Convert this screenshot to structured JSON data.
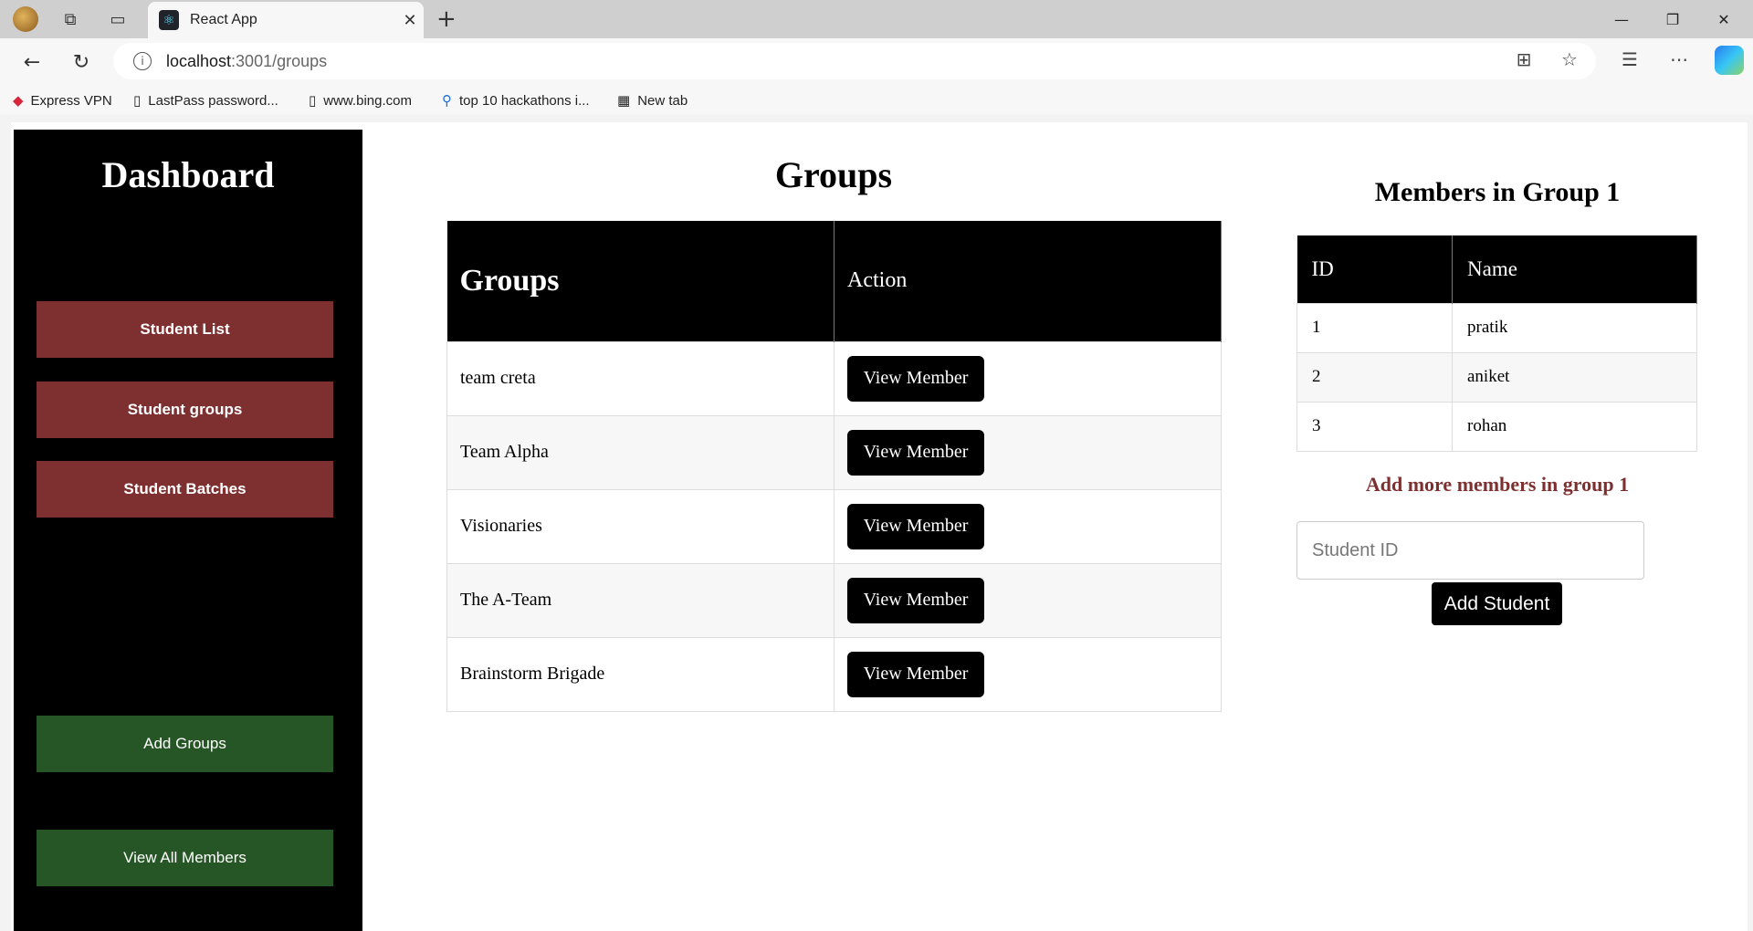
{
  "browser": {
    "tab_title": "React App",
    "tab_close": "✕",
    "new_tab": "+",
    "url_host": "localhost",
    "url_path": ":3001/groups",
    "bookmarks": [
      {
        "label": "Express VPN",
        "icon": "expressvpn-icon"
      },
      {
        "label": "LastPass password...",
        "icon": "page-icon"
      },
      {
        "label": "www.bing.com",
        "icon": "page-icon"
      },
      {
        "label": "top 10 hackathons i...",
        "icon": "search-icon"
      },
      {
        "label": "New tab",
        "icon": "newtab-icon"
      }
    ]
  },
  "sidebar": {
    "title": "Dashboard",
    "nav": [
      {
        "label": "Student List"
      },
      {
        "label": "Student groups"
      },
      {
        "label": "Student Batches"
      }
    ],
    "actions": [
      {
        "label": "Add Groups"
      },
      {
        "label": "View All Members"
      }
    ]
  },
  "groups": {
    "title": "Groups",
    "columns": [
      "Groups",
      "Action"
    ],
    "button_label": "View Member",
    "rows": [
      {
        "name": "team creta"
      },
      {
        "name": "Team Alpha"
      },
      {
        "name": "Visionaries"
      },
      {
        "name": "The A-Team"
      },
      {
        "name": "Brainstorm Brigade"
      }
    ]
  },
  "members": {
    "title": "Members in Group 1",
    "columns": [
      "ID",
      "Name"
    ],
    "rows": [
      {
        "id": "1",
        "name": "pratik"
      },
      {
        "id": "2",
        "name": "aniket"
      },
      {
        "id": "3",
        "name": "rohan"
      }
    ],
    "add_more_heading": "Add more members in group 1",
    "input_placeholder": "Student ID",
    "add_button": "Add Student"
  },
  "colors": {
    "sidebar_bg": "#000000",
    "nav_button": "#7e2f2f",
    "action_button": "#265626",
    "accent_text": "#7e2f2f"
  }
}
